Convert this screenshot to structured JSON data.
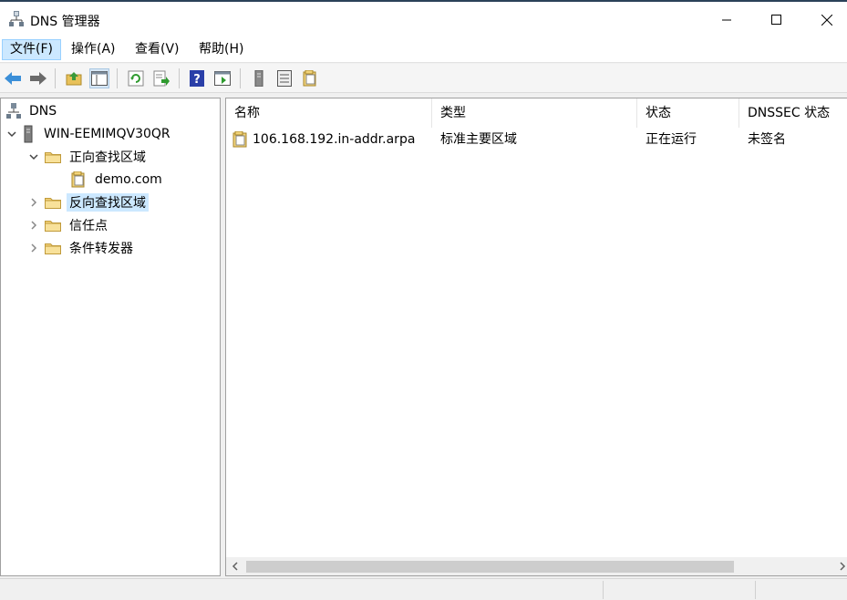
{
  "window": {
    "title": "DNS 管理器"
  },
  "menu": [
    "文件(F)",
    "操作(A)",
    "查看(V)",
    "帮助(H)"
  ],
  "tree": {
    "root": "DNS",
    "server": "WIN-EEMIMQV30QR",
    "forward_zones": "正向查找区域",
    "forward_child": "demo.com",
    "reverse_zones": "反向查找区域",
    "trust_points": "信任点",
    "conditional_forwarders": "条件转发器"
  },
  "list": {
    "columns": [
      "名称",
      "类型",
      "状态",
      "DNSSEC 状态"
    ],
    "rows": [
      {
        "name": "106.168.192.in-addr.arpa",
        "type": "标准主要区域",
        "status": "正在运行",
        "dnssec": "未签名"
      }
    ]
  },
  "colors": {
    "selection": "#cce8ff",
    "titlebar_accent": "#2b4159"
  }
}
